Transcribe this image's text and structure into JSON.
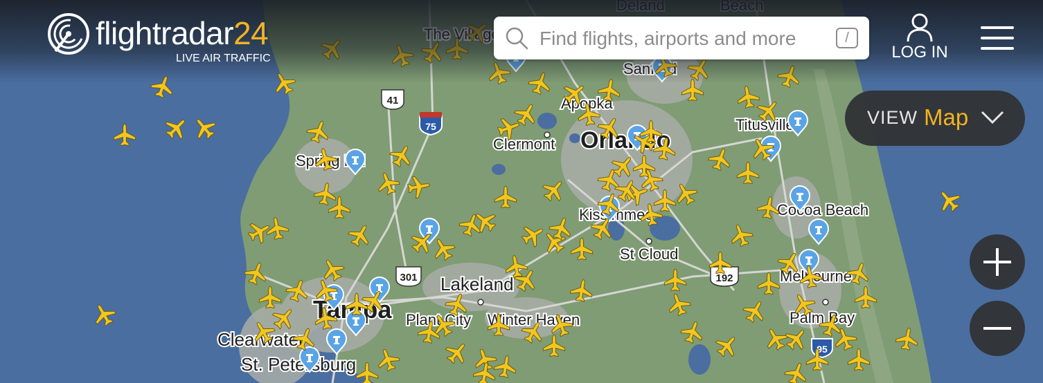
{
  "header": {
    "logo_text_main": "flightradar",
    "logo_text_accent": "24",
    "logo_subtitle": "LIVE AIR TRAFFIC",
    "search_placeholder": "Find flights, airports and more",
    "search_shortcut": "/",
    "login_label": "LOG IN"
  },
  "view_selector": {
    "label": "VIEW",
    "value": "Map"
  },
  "zoom": {
    "in_icon": "plus-icon",
    "out_icon": "minus-icon"
  },
  "map": {
    "city_labels": [
      {
        "name": "The Village",
        "size": 22
      },
      {
        "name": "Deland",
        "size": 22
      },
      {
        "name": "Beach",
        "size": 22
      },
      {
        "name": "Sanford",
        "size": 22
      },
      {
        "name": "Apopka",
        "size": 22
      },
      {
        "name": "Clermont",
        "size": 22
      },
      {
        "name": "Orlando",
        "size": 34
      },
      {
        "name": "Titusville",
        "size": 22
      },
      {
        "name": "Spring Hill",
        "size": 22
      },
      {
        "name": "Cocoa Beach",
        "size": 22
      },
      {
        "name": "Kissimmee",
        "size": 22
      },
      {
        "name": "St Cloud",
        "size": 22
      },
      {
        "name": "Lakeland",
        "size": 26
      },
      {
        "name": "Melbourne",
        "size": 22
      },
      {
        "name": "Tampa",
        "size": 36
      },
      {
        "name": "Plant City",
        "size": 22
      },
      {
        "name": "Winter Haven",
        "size": 22
      },
      {
        "name": "Palm Bay",
        "size": 22
      },
      {
        "name": "Clearwater",
        "size": 26
      },
      {
        "name": "St. Petersburg",
        "size": 26
      }
    ],
    "road_shields": [
      {
        "label": "41",
        "kind": "us"
      },
      {
        "label": "75",
        "kind": "interstate"
      },
      {
        "label": "301",
        "kind": "us"
      },
      {
        "label": "192",
        "kind": "us"
      },
      {
        "label": "95",
        "kind": "interstate"
      }
    ],
    "airport_marker_count": 16,
    "colors": {
      "water": "#4a6ea0",
      "land": "#7f9c74",
      "urban": "#a9ada8",
      "aircraft": "#f2c61f",
      "airport_marker": "#5aa4e6",
      "accent": "#f2b322"
    },
    "aircraft_icon": "airplane-icon"
  }
}
